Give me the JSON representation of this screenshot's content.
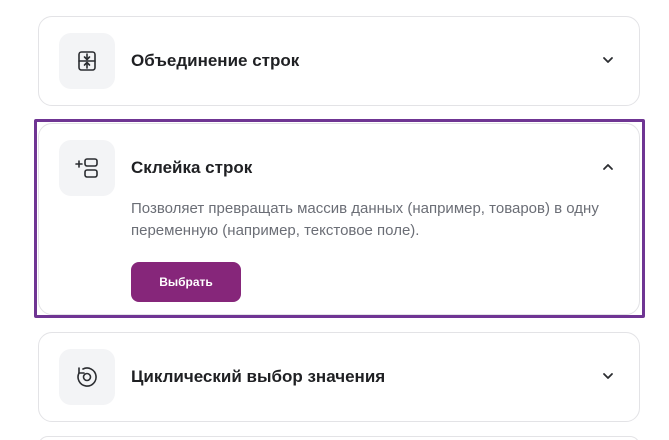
{
  "cards": [
    {
      "title": "Объединение строк",
      "icon": "merge-rows-icon",
      "expanded": false
    },
    {
      "title": "Склейка строк",
      "icon": "concat-rows-icon",
      "expanded": true,
      "description": "Позволяет превращать массив данных (например, товаров) в одну переменную (например, текстовое поле).",
      "button_label": "Выбрать"
    },
    {
      "title": "Циклический выбор значения",
      "icon": "cycle-select-icon",
      "expanded": false
    }
  ],
  "colors": {
    "accent": "#86267a",
    "outline": "#6f3593",
    "title": "#1f2023",
    "description": "#6b6e76",
    "icon_bg": "#f3f4f6",
    "border": "#e3e3e6"
  }
}
